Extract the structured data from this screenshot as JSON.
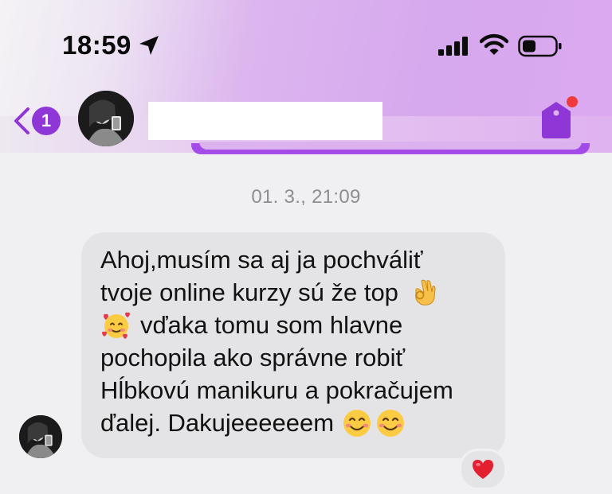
{
  "status_bar": {
    "time": "18:59",
    "icons": [
      "location-arrow-icon",
      "cellular-signal-icon",
      "wifi-icon",
      "battery-icon"
    ]
  },
  "header": {
    "unread_count": "1",
    "contact_name": "",
    "icons": [
      "back-chevron-icon",
      "contact-avatar",
      "tag-icon"
    ],
    "accent_color": "#8f37d6",
    "notification_dot_color": "#ef3b3b"
  },
  "conversation": {
    "timestamp": "01. 3., 21:09",
    "message": {
      "lines": [
        "Ahoj,musím sa aj ja pochváliť",
        "tvoje online kurzy sú že top",
        "vďaka tomu som hlavne",
        "pochopila ako správne robiť",
        "Hĺbkovú manikuru a pokračujem",
        "ďalej. Dakujeeeeeem"
      ],
      "emojis": [
        "ok-hand-emoji",
        "smiling-face-with-hearts-emoji",
        "smiling-face-emoji",
        "smiling-face-emoji"
      ]
    },
    "reaction": "heart-reaction-icon"
  }
}
